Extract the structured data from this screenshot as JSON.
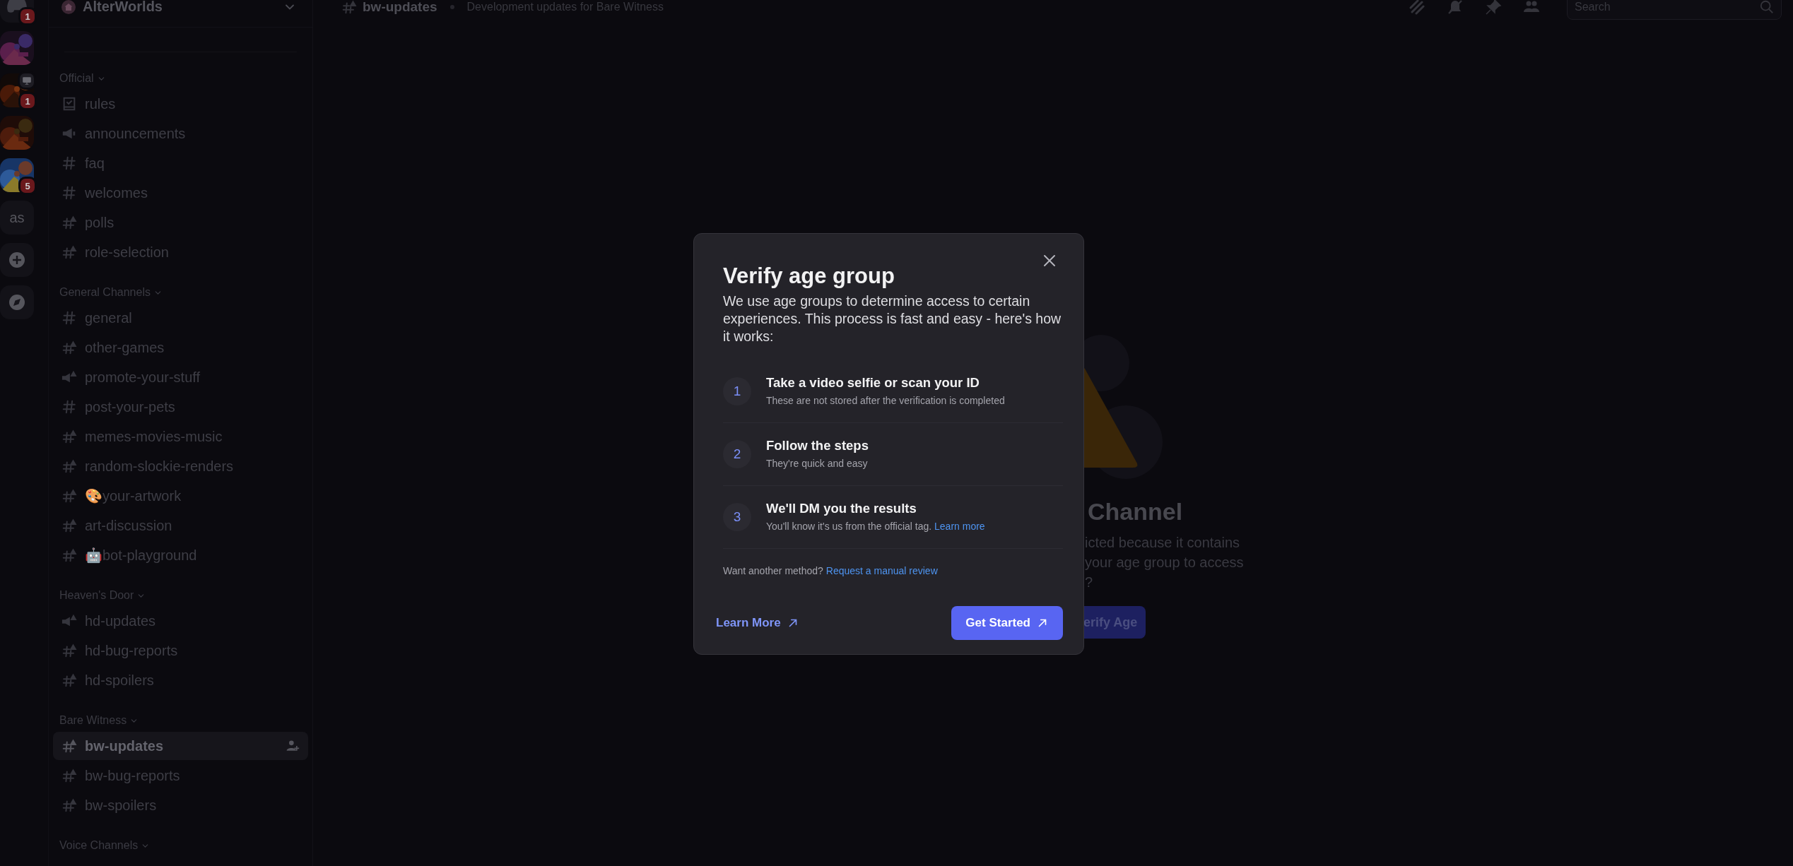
{
  "rail": [
    {
      "kind": "home",
      "badge": "1",
      "streaming": false
    },
    {
      "kind": "picture",
      "streaming": false
    },
    {
      "kind": "picture",
      "badge": "1",
      "streaming": true
    },
    {
      "kind": "picture",
      "streaming": false
    },
    {
      "kind": "picture",
      "badge": "5",
      "streaming": false
    },
    {
      "kind": "text",
      "label": "as",
      "streaming": false
    },
    {
      "kind": "add",
      "streaming": false
    },
    {
      "kind": "discover",
      "streaming": false
    }
  ],
  "server": {
    "name": "AlterWorlds"
  },
  "categories": [
    {
      "name": "Official",
      "channels": [
        {
          "name": "rules",
          "kind": "rules",
          "selected": false
        },
        {
          "name": "announcements",
          "kind": "announcement",
          "selected": false
        },
        {
          "name": "faq",
          "kind": "text",
          "selected": false
        },
        {
          "name": "welcomes",
          "kind": "text",
          "selected": false
        },
        {
          "name": "polls",
          "kind": "text-age",
          "selected": false
        },
        {
          "name": "role-selection",
          "kind": "text-age",
          "selected": false
        }
      ]
    },
    {
      "name": "General Channels",
      "channels": [
        {
          "name": "general",
          "kind": "text",
          "selected": false
        },
        {
          "name": "other-games",
          "kind": "text-age",
          "selected": false
        },
        {
          "name": "promote-your-stuff",
          "kind": "announcement-age",
          "selected": false
        },
        {
          "name": "post-your-pets",
          "kind": "text",
          "selected": false
        },
        {
          "name": "memes-movies-music",
          "kind": "text-age",
          "selected": false
        },
        {
          "name": "random-slockie-renders",
          "kind": "text-age",
          "selected": false
        },
        {
          "name": "🎨your-artwork",
          "kind": "text-age",
          "selected": false
        },
        {
          "name": "art-discussion",
          "kind": "text-age",
          "selected": false
        },
        {
          "name": "🤖bot-playground",
          "kind": "text-age",
          "selected": false
        }
      ]
    },
    {
      "name": "Heaven's Door",
      "channels": [
        {
          "name": "hd-updates",
          "kind": "announcement-age",
          "selected": false
        },
        {
          "name": "hd-bug-reports",
          "kind": "text-age",
          "selected": false
        },
        {
          "name": "hd-spoilers",
          "kind": "text-age",
          "selected": false
        }
      ]
    },
    {
      "name": "Bare Witness",
      "channels": [
        {
          "name": "bw-updates",
          "kind": "text-age",
          "selected": true
        },
        {
          "name": "bw-bug-reports",
          "kind": "text-age",
          "selected": false
        },
        {
          "name": "bw-spoilers",
          "kind": "text-age",
          "selected": false
        }
      ]
    },
    {
      "name": "Voice Channels"
    }
  ],
  "topbar": {
    "channel": "bw-updates",
    "kind": "text-age",
    "topic": "Development updates for Bare Witness",
    "search": {
      "placeholder": "Search"
    }
  },
  "restricted": {
    "title": "Channel",
    "lines": [
      "icted because it contains",
      "your age group to access",
      "?"
    ],
    "button": "erify Age"
  },
  "modal": {
    "title": "Verify age group",
    "description": "We use age groups to determine access to certain experiences. This process is fast and easy - here's how it works:",
    "steps": [
      {
        "number": "1",
        "title": "Take a video selfie or scan your ID",
        "detail": "These are not stored after the verification is completed"
      },
      {
        "number": "2",
        "title": "Follow the steps",
        "detail": "They're quick and easy"
      },
      {
        "number": "3",
        "title": "We'll DM you the results",
        "detail": "You'll know it's us from the official tag.",
        "link": "Learn more"
      }
    ],
    "footnote": "Want another method?",
    "footnote_link": "Request a manual review",
    "secondary": "Learn More",
    "primary": "Get Started"
  }
}
